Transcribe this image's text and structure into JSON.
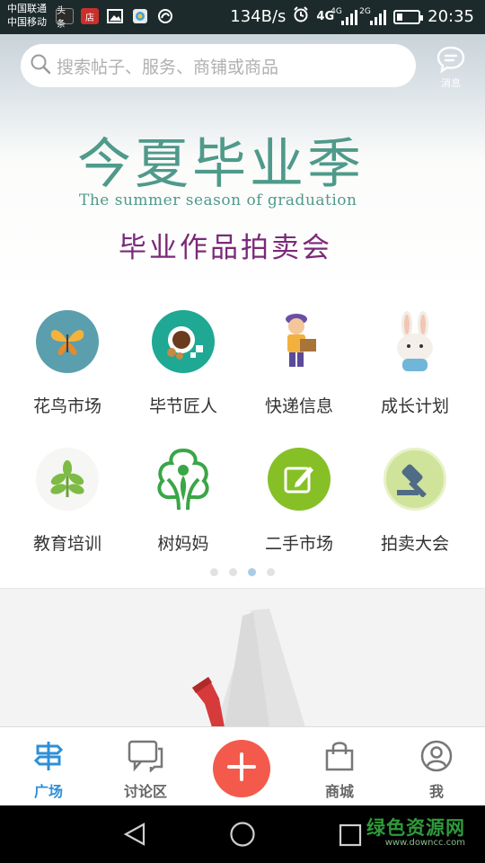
{
  "status_bar": {
    "carrier_1": "中国联通",
    "carrier_2": "中国移动",
    "app_icons": [
      "toutiao-icon",
      "dian-icon",
      "image-icon",
      "browser-icon",
      "app-icon"
    ],
    "app_1_text": "头条",
    "app_2_text": "店",
    "speed": "134B/s",
    "network_1": "4G",
    "network_2": "4G",
    "network_3": "2G",
    "time": "20:35"
  },
  "search": {
    "placeholder": "搜索帖子、服务、商铺或商品"
  },
  "messages": {
    "label": "消息"
  },
  "banner": {
    "title": "今夏毕业季",
    "subtitle": "The summer season of graduation",
    "event": "毕业作品拍卖会"
  },
  "categories": [
    {
      "label": "花鸟市场",
      "icon": "butterfly-icon"
    },
    {
      "label": "毕节匠人",
      "icon": "coffee-icon"
    },
    {
      "label": "快递信息",
      "icon": "courier-icon"
    },
    {
      "label": "成长计划",
      "icon": "bunny-icon"
    },
    {
      "label": "教育培训",
      "icon": "leaf-icon"
    },
    {
      "label": "树妈妈",
      "icon": "tree-icon"
    },
    {
      "label": "二手市场",
      "icon": "edit-icon"
    },
    {
      "label": "拍卖大会",
      "icon": "gavel-icon"
    }
  ],
  "pager": {
    "count": 4,
    "active_index": 2
  },
  "tabs": [
    {
      "label": "广场",
      "icon": "signpost-icon",
      "active": true
    },
    {
      "label": "讨论区",
      "icon": "chat-icon",
      "active": false
    },
    {
      "label": "",
      "icon": "plus-icon",
      "active": false
    },
    {
      "label": "商城",
      "icon": "bag-icon",
      "active": false
    },
    {
      "label": "我",
      "icon": "user-icon",
      "active": false
    }
  ],
  "colors": {
    "accent": "#2e8fd6",
    "fab": "#f35a4c",
    "banner_green": "#4f9a8a",
    "banner_purple": "#7a2a78"
  },
  "watermark": {
    "title": "绿色资源网",
    "url": "www.downcc.com"
  }
}
